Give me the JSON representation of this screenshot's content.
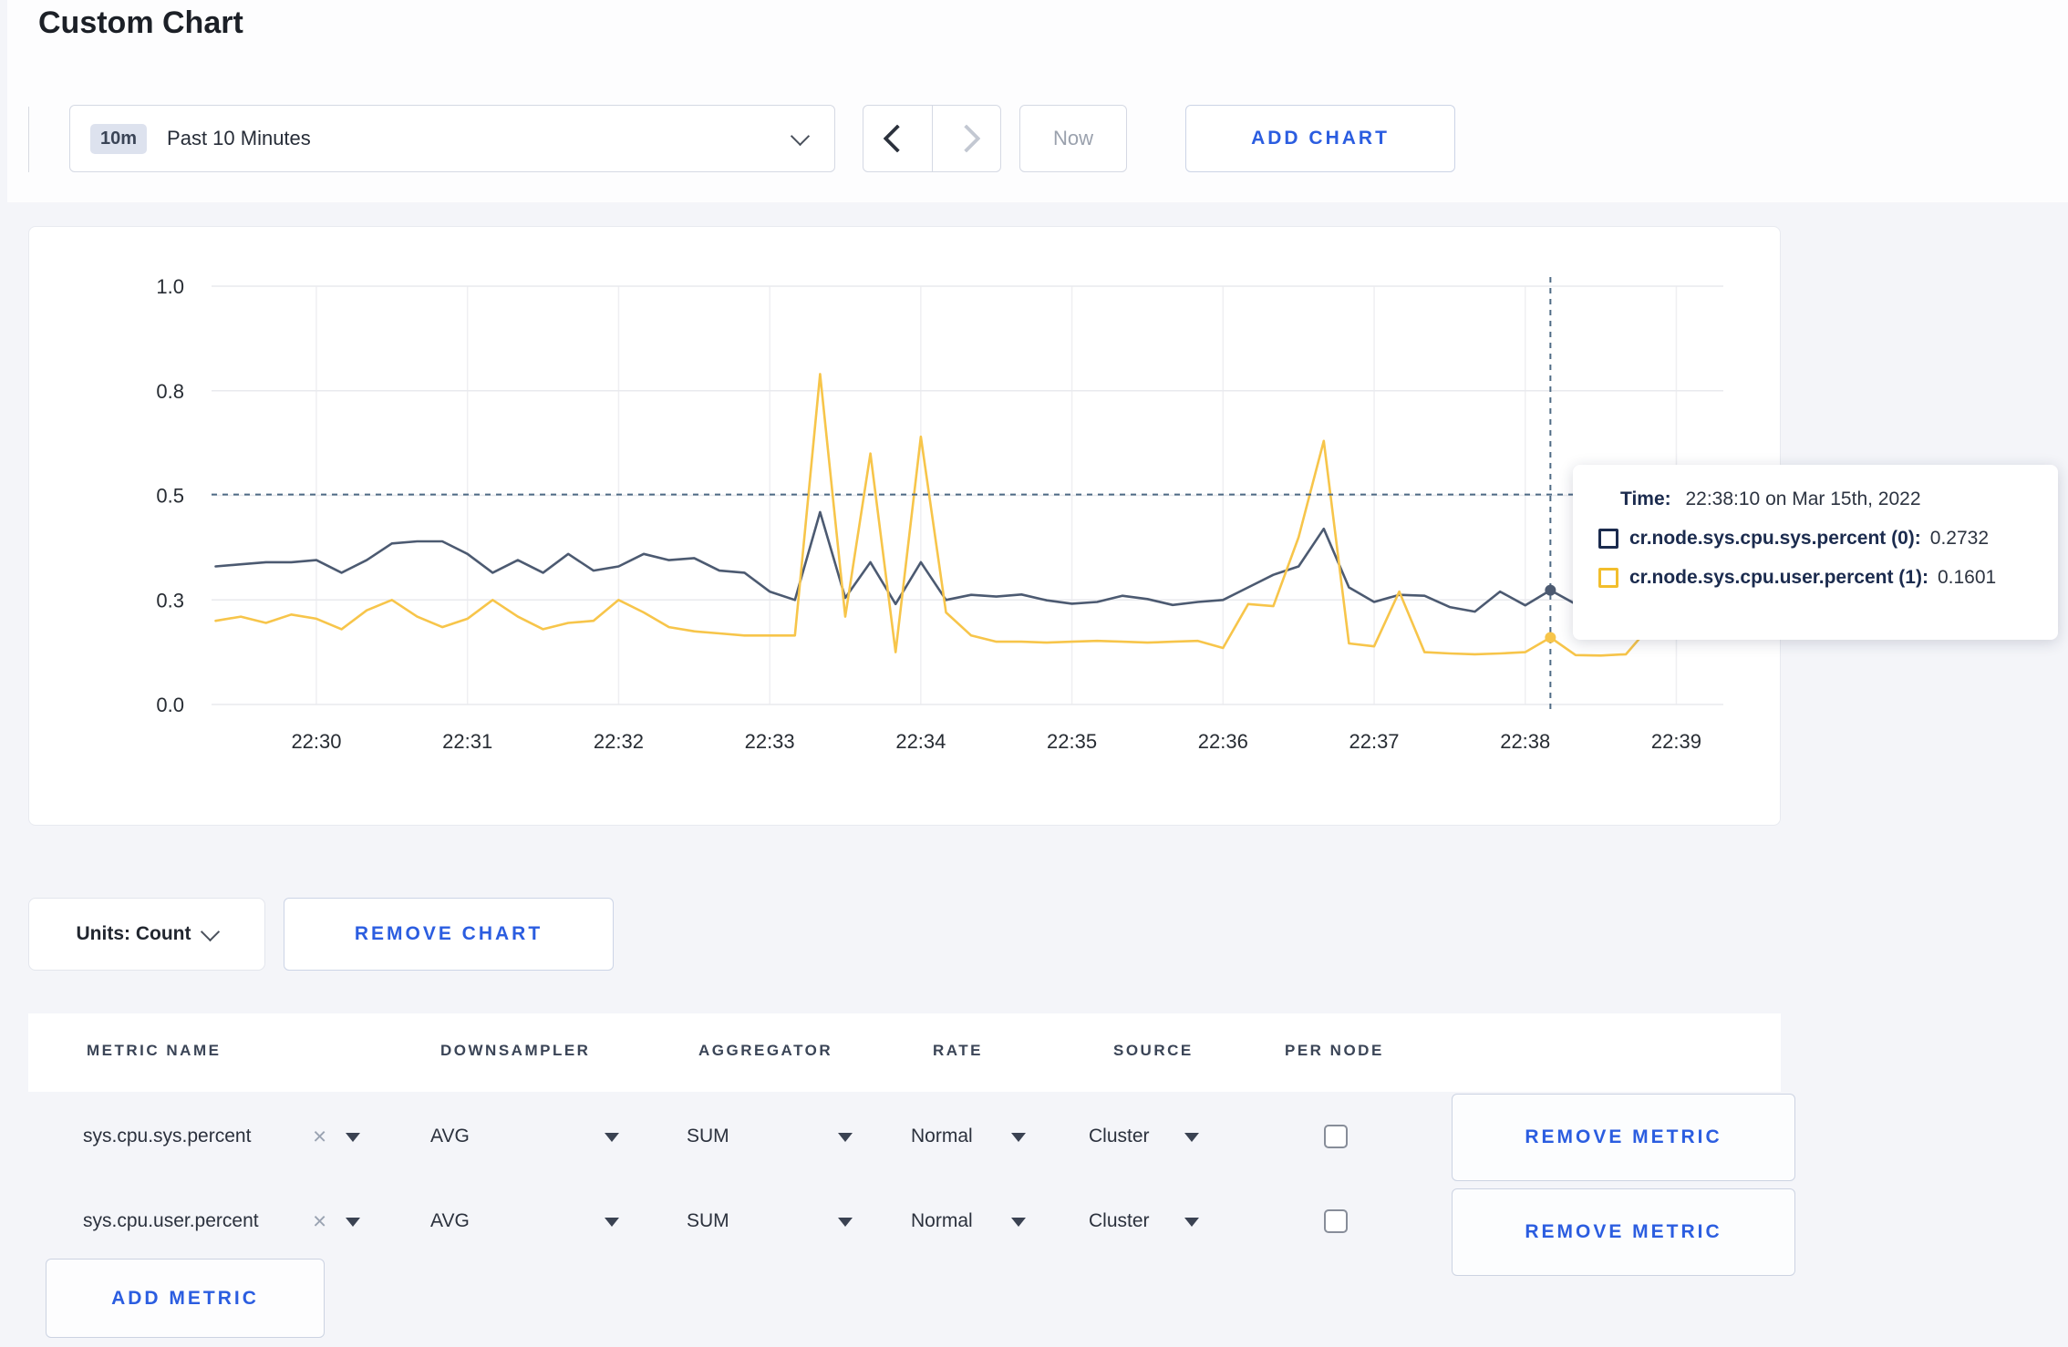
{
  "page": {
    "title": "Custom Chart"
  },
  "toolbar": {
    "range_badge": "10m",
    "range_label": "Past 10 Minutes",
    "now_label": "Now",
    "add_chart_label": "ADD CHART"
  },
  "colors": {
    "accent_blue": "#2b5de0",
    "series_sys": "#4c5a71",
    "series_user": "#f7c54a",
    "legend_sys": "#1b2b4e",
    "legend_user": "#f2be2c",
    "crosshair": "#4f6b85"
  },
  "chart_data": {
    "type": "line",
    "title": "",
    "xlabel": "",
    "ylabel": "",
    "ylim": [
      0,
      1
    ],
    "grid": true,
    "x_start": "22:29:20",
    "x_step_seconds": 10,
    "x_ticks": [
      "22:30",
      "22:31",
      "22:32",
      "22:33",
      "22:34",
      "22:35",
      "22:36",
      "22:37",
      "22:38",
      "22:39"
    ],
    "x_tick_indices": [
      4,
      10,
      16,
      22,
      28,
      34,
      40,
      46,
      52,
      58
    ],
    "y_ticks": [
      {
        "label": "0.0",
        "value": 0
      },
      {
        "label": "0.3",
        "value": 0.25
      },
      {
        "label": "0.5",
        "value": 0.5
      },
      {
        "label": "0.8",
        "value": 0.75
      },
      {
        "label": "1.0",
        "value": 1.0
      }
    ],
    "series": [
      {
        "name": "cr.node.sys.cpu.sys.percent",
        "color": "#4c5a71",
        "values": [
          0.33,
          0.335,
          0.34,
          0.34,
          0.345,
          0.315,
          0.345,
          0.385,
          0.39,
          0.39,
          0.36,
          0.315,
          0.345,
          0.315,
          0.36,
          0.32,
          0.33,
          0.36,
          0.345,
          0.35,
          0.32,
          0.315,
          0.27,
          0.25,
          0.46,
          0.255,
          0.34,
          0.24,
          0.34,
          0.25,
          0.262,
          0.258,
          0.263,
          0.249,
          0.241,
          0.245,
          0.26,
          0.252,
          0.238,
          0.245,
          0.25,
          0.28,
          0.31,
          0.33,
          0.42,
          0.28,
          0.245,
          0.262,
          0.26,
          0.233,
          0.222,
          0.27,
          0.237,
          0.2732,
          0.24,
          0.255,
          0.25,
          0.245,
          0.25,
          0.255
        ]
      },
      {
        "name": "cr.node.sys.cpu.user.percent",
        "color": "#f7c54a",
        "values": [
          0.2,
          0.21,
          0.195,
          0.215,
          0.205,
          0.18,
          0.225,
          0.25,
          0.21,
          0.185,
          0.205,
          0.25,
          0.21,
          0.18,
          0.195,
          0.2,
          0.25,
          0.22,
          0.185,
          0.175,
          0.17,
          0.165,
          0.165,
          0.165,
          0.79,
          0.21,
          0.6,
          0.125,
          0.64,
          0.22,
          0.165,
          0.15,
          0.15,
          0.148,
          0.15,
          0.152,
          0.15,
          0.148,
          0.15,
          0.152,
          0.135,
          0.24,
          0.235,
          0.4,
          0.63,
          0.146,
          0.139,
          0.27,
          0.125,
          0.122,
          0.12,
          0.122,
          0.125,
          0.1601,
          0.118,
          0.117,
          0.12,
          0.19,
          0.28,
          0.22
        ]
      }
    ],
    "crosshair": {
      "t_index": 53,
      "y_value": 0.502
    },
    "highlight_points": [
      {
        "series": 0,
        "t_index": 53,
        "value": 0.2732
      },
      {
        "series": 1,
        "t_index": 53,
        "value": 0.1601
      }
    ]
  },
  "tooltip": {
    "time_label": "Time:",
    "time_value": "22:38:10 on Mar 15th, 2022",
    "series": [
      {
        "label": "cr.node.sys.cpu.sys.percent (0):",
        "value": "0.2732",
        "color": "#1b2b4e"
      },
      {
        "label": "cr.node.sys.cpu.user.percent (1):",
        "value": "0.1601",
        "color": "#f2be2c"
      }
    ]
  },
  "chart_footer": {
    "units_label": "Units: Count",
    "remove_chart_label": "REMOVE CHART"
  },
  "metrics_table": {
    "headers": [
      "METRIC NAME",
      "DOWNSAMPLER",
      "AGGREGATOR",
      "RATE",
      "SOURCE",
      "PER NODE"
    ],
    "remove_metric_label": "REMOVE METRIC",
    "add_metric_label": "ADD METRIC",
    "rows": [
      {
        "metric_name": "sys.cpu.sys.percent",
        "downsampler": "AVG",
        "aggregator": "SUM",
        "rate": "Normal",
        "source": "Cluster",
        "per_node_checked": false
      },
      {
        "metric_name": "sys.cpu.user.percent",
        "downsampler": "AVG",
        "aggregator": "SUM",
        "rate": "Normal",
        "source": "Cluster",
        "per_node_checked": false
      }
    ]
  }
}
